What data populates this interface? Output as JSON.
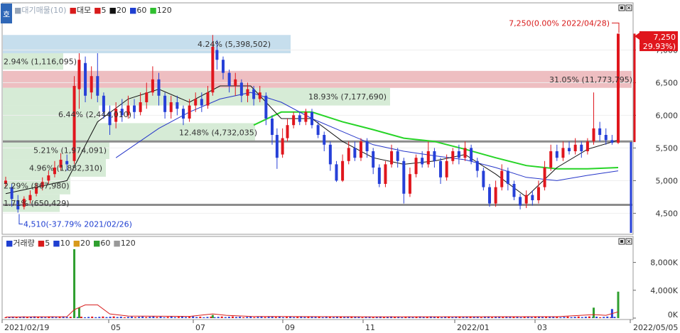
{
  "header": {
    "corner_label": "호",
    "price_legend": [
      {
        "text": "대기매물(10)",
        "color": "#9aa7b8"
      },
      {
        "text": "대모",
        "color": "#d81b1b"
      },
      {
        "text": "5",
        "color": "#d81b1b"
      },
      {
        "text": "20",
        "color": "#111111"
      },
      {
        "text": "60",
        "color": "#1f3fd1"
      },
      {
        "text": "120",
        "color": "#2fbf2f"
      }
    ],
    "volume_legend": [
      {
        "text": "거래량",
        "color": "#1f3fd1"
      },
      {
        "text": "5",
        "color": "#d81b1b"
      },
      {
        "text": "10",
        "color": "#1f3fd1"
      },
      {
        "text": "20",
        "color": "#d89a1b"
      },
      {
        "text": "60",
        "color": "#2f9f2f"
      },
      {
        "text": "120",
        "color": "#999999"
      }
    ]
  },
  "colors": {
    "up": "#e0161d",
    "down": "#2640d8",
    "ma20": "#111111",
    "ma60": "#2636c9",
    "ma120": "#27d427",
    "zone_red": "#ebb3b6",
    "zone_blue": "#bcd8ea",
    "zone_green": "#cfe8cf",
    "support": "#8c8c8c"
  },
  "chart_data": {
    "type": "candlestick",
    "price_axis": {
      "min": 4200,
      "max": 7700,
      "ticks": [
        4500,
        5000,
        5500,
        6000,
        6500,
        7000
      ],
      "tick_labels": [
        "4,500",
        "5,000",
        "5,500",
        "6,000",
        "6,500",
        "7,000"
      ]
    },
    "volume_axis": {
      "max": 10000,
      "ticks": [
        0,
        4000,
        8000
      ],
      "tick_labels": [
        "0K",
        "4,000K",
        "8,000K"
      ]
    },
    "time_axis": {
      "start": "2021/02/19",
      "end": "2022/05/05",
      "labels": [
        "2021/02/19",
        "05",
        "07",
        "09",
        "11",
        "2022/01",
        "03",
        "2022/05/05"
      ]
    },
    "current": {
      "price": 7250,
      "price_label": "7,250",
      "change_label": "( 29.93%)"
    },
    "annotations": {
      "high": {
        "price": 7250,
        "text": "7,250(0.00% 2022/04/28)"
      },
      "low": {
        "price": 4510,
        "text": "4,510(-37.79% 2021/02/26)"
      }
    },
    "support_lines": [
      5600,
      4630
    ],
    "volume_profile": [
      {
        "price_from": 6950,
        "price_to": 7230,
        "text": "4.24% (5,398,502)",
        "color": "blue"
      },
      {
        "price_from": 6420,
        "price_to": 6680,
        "text": "31.05% (11,773,795)",
        "color": "red"
      },
      {
        "price_from": 6700,
        "price_to": 6950,
        "text": "2.94% (1,116,095)",
        "color": "green"
      },
      {
        "price_from": 6150,
        "price_to": 6420,
        "text": "18.93% (7,177,690)",
        "color": "green"
      },
      {
        "price_from": 5880,
        "price_to": 6150,
        "text": "6.44% (2,444,010)",
        "color": "green"
      },
      {
        "price_from": 5600,
        "price_to": 5880,
        "text": "12.48% (4,732,035)",
        "color": "green"
      },
      {
        "price_from": 5330,
        "price_to": 5600,
        "text": "5.21% (1,974,091)",
        "color": "green"
      },
      {
        "price_from": 5060,
        "price_to": 5330,
        "text": "4.96% (1,882,310)",
        "color": "green"
      },
      {
        "price_from": 4790,
        "price_to": 5060,
        "text": "2.29% (867,980)",
        "color": "green"
      },
      {
        "price_from": 4520,
        "price_to": 4790,
        "text": "1.71% (650,429)",
        "color": "green"
      }
    ],
    "price_series": [
      {
        "t": 0,
        "o": 4950,
        "c": 5000,
        "h": 5060,
        "l": 4900
      },
      {
        "t": 0.01,
        "o": 4900,
        "c": 4720,
        "h": 4950,
        "l": 4600
      },
      {
        "t": 0.02,
        "o": 4700,
        "c": 4560,
        "h": 4780,
        "l": 4510
      },
      {
        "t": 0.03,
        "o": 4600,
        "c": 4720,
        "h": 4760,
        "l": 4560
      },
      {
        "t": 0.04,
        "o": 4700,
        "c": 4780,
        "h": 4850,
        "l": 4650
      },
      {
        "t": 0.05,
        "o": 4800,
        "c": 4900,
        "h": 4960,
        "l": 4760
      },
      {
        "t": 0.06,
        "o": 4900,
        "c": 4980,
        "h": 5050,
        "l": 4850
      },
      {
        "t": 0.07,
        "o": 5000,
        "c": 5080,
        "h": 5150,
        "l": 4950
      },
      {
        "t": 0.08,
        "o": 5100,
        "c": 5200,
        "h": 5300,
        "l": 5050
      },
      {
        "t": 0.09,
        "o": 5200,
        "c": 5320,
        "h": 5420,
        "l": 5150
      },
      {
        "t": 0.1,
        "o": 5300,
        "c": 5250,
        "h": 5400,
        "l": 5150
      },
      {
        "t": 0.112,
        "o": 5300,
        "c": 6450,
        "h": 6600,
        "l": 5250
      },
      {
        "t": 0.12,
        "o": 6400,
        "c": 6850,
        "h": 6950,
        "l": 6100
      },
      {
        "t": 0.13,
        "o": 6800,
        "c": 6300,
        "h": 6900,
        "l": 6200
      },
      {
        "t": 0.14,
        "o": 6350,
        "c": 6600,
        "h": 6750,
        "l": 6250
      },
      {
        "t": 0.15,
        "o": 6600,
        "c": 6300,
        "h": 6950,
        "l": 6200
      },
      {
        "t": 0.16,
        "o": 6300,
        "c": 6050,
        "h": 6350,
        "l": 5950
      },
      {
        "t": 0.17,
        "o": 6050,
        "c": 5850,
        "h": 6150,
        "l": 5700
      },
      {
        "t": 0.18,
        "o": 5900,
        "c": 6100,
        "h": 6200,
        "l": 5800
      },
      {
        "t": 0.19,
        "o": 6100,
        "c": 6000,
        "h": 6250,
        "l": 5900
      },
      {
        "t": 0.2,
        "o": 6000,
        "c": 6150,
        "h": 6300,
        "l": 5950
      },
      {
        "t": 0.21,
        "o": 6150,
        "c": 6050,
        "h": 6250,
        "l": 5950
      },
      {
        "t": 0.22,
        "o": 6050,
        "c": 6200,
        "h": 6350,
        "l": 6000
      },
      {
        "t": 0.23,
        "o": 6200,
        "c": 6350,
        "h": 6500,
        "l": 6100
      },
      {
        "t": 0.24,
        "o": 6350,
        "c": 6550,
        "h": 6750,
        "l": 6300
      },
      {
        "t": 0.25,
        "o": 6550,
        "c": 6300,
        "h": 6650,
        "l": 6150
      },
      {
        "t": 0.26,
        "o": 6300,
        "c": 6050,
        "h": 6350,
        "l": 5950
      },
      {
        "t": 0.27,
        "o": 6050,
        "c": 6200,
        "h": 6300,
        "l": 5950
      },
      {
        "t": 0.28,
        "o": 6200,
        "c": 6100,
        "h": 6300,
        "l": 6000
      },
      {
        "t": 0.29,
        "o": 6100,
        "c": 5950,
        "h": 6150,
        "l": 5850
      },
      {
        "t": 0.3,
        "o": 5950,
        "c": 6150,
        "h": 6250,
        "l": 5900
      },
      {
        "t": 0.31,
        "o": 6150,
        "c": 6250,
        "h": 6350,
        "l": 6050
      },
      {
        "t": 0.32,
        "o": 6250,
        "c": 6150,
        "h": 6350,
        "l": 6050
      },
      {
        "t": 0.33,
        "o": 6150,
        "c": 6350,
        "h": 6450,
        "l": 6100
      },
      {
        "t": 0.338,
        "o": 6350,
        "c": 7050,
        "h": 7230,
        "l": 6300
      },
      {
        "t": 0.345,
        "o": 7000,
        "c": 6850,
        "h": 7150,
        "l": 6700
      },
      {
        "t": 0.355,
        "o": 6850,
        "c": 6650,
        "h": 6900,
        "l": 6550
      },
      {
        "t": 0.365,
        "o": 6650,
        "c": 6450,
        "h": 6700,
        "l": 6350
      },
      {
        "t": 0.375,
        "o": 6450,
        "c": 6550,
        "h": 6650,
        "l": 6300
      },
      {
        "t": 0.385,
        "o": 6500,
        "c": 6300,
        "h": 6550,
        "l": 6200
      },
      {
        "t": 0.395,
        "o": 6300,
        "c": 6400,
        "h": 6500,
        "l": 6200
      },
      {
        "t": 0.405,
        "o": 6400,
        "c": 6250,
        "h": 6450,
        "l": 6150
      },
      {
        "t": 0.415,
        "o": 6250,
        "c": 6350,
        "h": 6450,
        "l": 6200
      },
      {
        "t": 0.425,
        "o": 6300,
        "c": 5950,
        "h": 6350,
        "l": 5850
      },
      {
        "t": 0.435,
        "o": 5950,
        "c": 5700,
        "h": 6000,
        "l": 5550
      },
      {
        "t": 0.443,
        "o": 5700,
        "c": 5350,
        "h": 5800,
        "l": 5180
      },
      {
        "t": 0.452,
        "o": 5400,
        "c": 5650,
        "h": 5800,
        "l": 5350
      },
      {
        "t": 0.46,
        "o": 5650,
        "c": 5850,
        "h": 5950,
        "l": 5600
      },
      {
        "t": 0.47,
        "o": 5850,
        "c": 6000,
        "h": 6050,
        "l": 5800
      },
      {
        "t": 0.48,
        "o": 6000,
        "c": 5900,
        "h": 6050,
        "l": 5850
      },
      {
        "t": 0.49,
        "o": 5900,
        "c": 6050,
        "h": 6100,
        "l": 5850
      },
      {
        "t": 0.5,
        "o": 6050,
        "c": 5850,
        "h": 6100,
        "l": 5800
      },
      {
        "t": 0.51,
        "o": 5850,
        "c": 5700,
        "h": 5900,
        "l": 5650
      },
      {
        "t": 0.52,
        "o": 5700,
        "c": 5550,
        "h": 5750,
        "l": 5450
      },
      {
        "t": 0.53,
        "o": 5550,
        "c": 5250,
        "h": 5600,
        "l": 5150
      },
      {
        "t": 0.54,
        "o": 5250,
        "c": 5000,
        "h": 5300,
        "l": 4980
      },
      {
        "t": 0.55,
        "o": 5000,
        "c": 5300,
        "h": 5400,
        "l": 4980
      },
      {
        "t": 0.56,
        "o": 5300,
        "c": 5500,
        "h": 5600,
        "l": 5250
      },
      {
        "t": 0.57,
        "o": 5500,
        "c": 5350,
        "h": 5600,
        "l": 5300
      },
      {
        "t": 0.58,
        "o": 5350,
        "c": 5600,
        "h": 5650,
        "l": 5300
      },
      {
        "t": 0.59,
        "o": 5600,
        "c": 5450,
        "h": 5650,
        "l": 5350
      },
      {
        "t": 0.6,
        "o": 5450,
        "c": 5200,
        "h": 5500,
        "l": 5100
      },
      {
        "t": 0.61,
        "o": 5200,
        "c": 4950,
        "h": 5250,
        "l": 4900
      },
      {
        "t": 0.62,
        "o": 4950,
        "c": 5250,
        "h": 5300,
        "l": 4900
      },
      {
        "t": 0.63,
        "o": 5250,
        "c": 5450,
        "h": 5550,
        "l": 5200
      },
      {
        "t": 0.64,
        "o": 5450,
        "c": 5300,
        "h": 5500,
        "l": 5200
      },
      {
        "t": 0.65,
        "o": 5300,
        "c": 4800,
        "h": 5350,
        "l": 4650
      },
      {
        "t": 0.66,
        "o": 4800,
        "c": 5100,
        "h": 5200,
        "l": 4750
      },
      {
        "t": 0.67,
        "o": 5100,
        "c": 5350,
        "h": 5400,
        "l": 5050
      },
      {
        "t": 0.68,
        "o": 5350,
        "c": 5250,
        "h": 5450,
        "l": 5200
      },
      {
        "t": 0.69,
        "o": 5250,
        "c": 5450,
        "h": 5600,
        "l": 5200
      },
      {
        "t": 0.7,
        "o": 5450,
        "c": 5300,
        "h": 5500,
        "l": 5200
      },
      {
        "t": 0.71,
        "o": 5300,
        "c": 5050,
        "h": 5350,
        "l": 4950
      },
      {
        "t": 0.72,
        "o": 5050,
        "c": 5300,
        "h": 5400,
        "l": 5000
      },
      {
        "t": 0.73,
        "o": 5300,
        "c": 5450,
        "h": 5500,
        "l": 5250
      },
      {
        "t": 0.74,
        "o": 5450,
        "c": 5350,
        "h": 5550,
        "l": 5250
      },
      {
        "t": 0.75,
        "o": 5350,
        "c": 5500,
        "h": 5600,
        "l": 5300
      },
      {
        "t": 0.76,
        "o": 5500,
        "c": 5300,
        "h": 5550,
        "l": 5250
      },
      {
        "t": 0.77,
        "o": 5300,
        "c": 5150,
        "h": 5350,
        "l": 5050
      },
      {
        "t": 0.78,
        "o": 5150,
        "c": 4900,
        "h": 5200,
        "l": 4850
      },
      {
        "t": 0.79,
        "o": 4900,
        "c": 4650,
        "h": 4950,
        "l": 4600
      },
      {
        "t": 0.8,
        "o": 4650,
        "c": 4900,
        "h": 5000,
        "l": 4600
      },
      {
        "t": 0.81,
        "o": 4900,
        "c": 5150,
        "h": 5250,
        "l": 4850
      },
      {
        "t": 0.82,
        "o": 5150,
        "c": 4950,
        "h": 5200,
        "l": 4850
      },
      {
        "t": 0.83,
        "o": 4950,
        "c": 4750,
        "h": 5000,
        "l": 4700
      },
      {
        "t": 0.84,
        "o": 4750,
        "c": 4620,
        "h": 4800,
        "l": 4560
      },
      {
        "t": 0.85,
        "o": 4650,
        "c": 4780,
        "h": 4850,
        "l": 4580
      },
      {
        "t": 0.86,
        "o": 4780,
        "c": 4700,
        "h": 4850,
        "l": 4620
      },
      {
        "t": 0.87,
        "o": 4700,
        "c": 4900,
        "h": 5000,
        "l": 4650
      },
      {
        "t": 0.88,
        "o": 4900,
        "c": 5200,
        "h": 5300,
        "l": 4850
      },
      {
        "t": 0.89,
        "o": 5200,
        "c": 5450,
        "h": 5550,
        "l": 5150
      },
      {
        "t": 0.9,
        "o": 5450,
        "c": 5350,
        "h": 5550,
        "l": 5300
      },
      {
        "t": 0.91,
        "o": 5350,
        "c": 5500,
        "h": 5600,
        "l": 5300
      },
      {
        "t": 0.92,
        "o": 5500,
        "c": 5450,
        "h": 5600,
        "l": 5400
      },
      {
        "t": 0.93,
        "o": 5450,
        "c": 5550,
        "h": 5650,
        "l": 5400
      },
      {
        "t": 0.94,
        "o": 5550,
        "c": 5450,
        "h": 5600,
        "l": 5350
      },
      {
        "t": 0.95,
        "o": 5450,
        "c": 5600,
        "h": 5650,
        "l": 5400
      },
      {
        "t": 0.96,
        "o": 5600,
        "c": 5800,
        "h": 6350,
        "l": 5550
      },
      {
        "t": 0.97,
        "o": 5800,
        "c": 5700,
        "h": 5900,
        "l": 5600
      },
      {
        "t": 0.98,
        "o": 5700,
        "c": 5620,
        "h": 5800,
        "l": 5550
      },
      {
        "t": 0.99,
        "o": 5620,
        "c": 5580,
        "h": 5700,
        "l": 5550
      },
      {
        "t": 1.0,
        "o": 5580,
        "c": 7250,
        "h": 7250,
        "l": 5560
      }
    ],
    "ma20": [
      [
        0,
        4800
      ],
      [
        0.1,
        5000
      ],
      [
        0.15,
        5900
      ],
      [
        0.2,
        6250
      ],
      [
        0.25,
        6400
      ],
      [
        0.3,
        6200
      ],
      [
        0.35,
        6450
      ],
      [
        0.4,
        6450
      ],
      [
        0.45,
        5950
      ],
      [
        0.5,
        5950
      ],
      [
        0.55,
        5600
      ],
      [
        0.6,
        5350
      ],
      [
        0.65,
        5250
      ],
      [
        0.7,
        5300
      ],
      [
        0.75,
        5400
      ],
      [
        0.8,
        5100
      ],
      [
        0.85,
        4750
      ],
      [
        0.9,
        5200
      ],
      [
        0.95,
        5480
      ],
      [
        1.0,
        5620
      ]
    ],
    "ma60": [
      [
        0.18,
        5350
      ],
      [
        0.25,
        5800
      ],
      [
        0.3,
        6050
      ],
      [
        0.35,
        6250
      ],
      [
        0.4,
        6350
      ],
      [
        0.45,
        6200
      ],
      [
        0.5,
        5950
      ],
      [
        0.55,
        5750
      ],
      [
        0.6,
        5550
      ],
      [
        0.65,
        5450
      ],
      [
        0.7,
        5380
      ],
      [
        0.75,
        5320
      ],
      [
        0.8,
        5200
      ],
      [
        0.85,
        5050
      ],
      [
        0.9,
        5000
      ],
      [
        0.95,
        5080
      ],
      [
        1.0,
        5150
      ]
    ],
    "ma120": [
      [
        0.405,
        5850
      ],
      [
        0.45,
        6050
      ],
      [
        0.5,
        6050
      ],
      [
        0.55,
        5900
      ],
      [
        0.6,
        5780
      ],
      [
        0.65,
        5650
      ],
      [
        0.7,
        5600
      ],
      [
        0.75,
        5480
      ],
      [
        0.8,
        5350
      ],
      [
        0.85,
        5230
      ],
      [
        0.9,
        5180
      ],
      [
        0.95,
        5180
      ],
      [
        1.0,
        5200
      ]
    ],
    "volume_series": [
      {
        "t": 0.112,
        "v": 9900,
        "up": true
      },
      {
        "t": 0.12,
        "v": 1500,
        "up": true
      },
      {
        "t": 0.338,
        "v": 450,
        "up": true
      },
      {
        "t": 0.96,
        "v": 1500,
        "up": true
      },
      {
        "t": 0.99,
        "v": 1300,
        "up": false
      },
      {
        "t": 1.0,
        "v": 3800,
        "up": true
      }
    ],
    "volume_base": 120,
    "volume_ma5": [
      [
        0,
        150
      ],
      [
        0.1,
        200
      ],
      [
        0.112,
        1200
      ],
      [
        0.13,
        1900
      ],
      [
        0.15,
        1900
      ],
      [
        0.17,
        600
      ],
      [
        0.2,
        300
      ],
      [
        0.3,
        250
      ],
      [
        0.338,
        600
      ],
      [
        0.36,
        400
      ],
      [
        0.4,
        250
      ],
      [
        0.6,
        180
      ],
      [
        0.9,
        200
      ],
      [
        0.96,
        500
      ],
      [
        0.98,
        400
      ],
      [
        1.0,
        900
      ]
    ]
  }
}
